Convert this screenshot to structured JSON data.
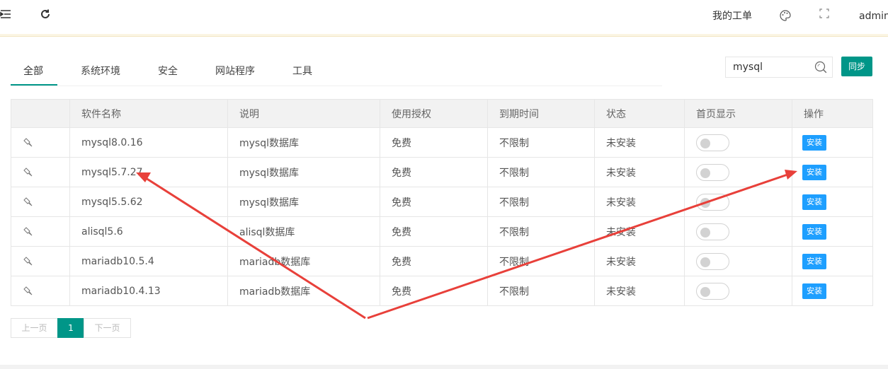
{
  "topbar": {
    "menu_icon": "menu-fold-icon",
    "refresh_icon": "refresh-icon",
    "workorder_label": "我的工单",
    "theme_icon": "palette-icon",
    "fullscreen_icon": "fullscreen-icon",
    "user_label": "admin"
  },
  "tabs": [
    {
      "label": "全部",
      "active": true
    },
    {
      "label": "系统环境",
      "active": false
    },
    {
      "label": "安全",
      "active": false
    },
    {
      "label": "网站程序",
      "active": false
    },
    {
      "label": "工具",
      "active": false
    }
  ],
  "search": {
    "value": "mysql",
    "icon": "search-icon"
  },
  "sync_label": "同步",
  "table": {
    "headers": [
      "",
      "软件名称",
      "说明",
      "使用授权",
      "到期时间",
      "状态",
      "首页显示",
      "操作"
    ],
    "rows": [
      {
        "name": "mysql8.0.16",
        "desc": "mysql数据库",
        "license": "免费",
        "expire": "不限制",
        "status": "未安装",
        "action": "安装"
      },
      {
        "name": "mysql5.7.27",
        "desc": "mysql数据库",
        "license": "免费",
        "expire": "不限制",
        "status": "未安装",
        "action": "安装"
      },
      {
        "name": "mysql5.5.62",
        "desc": "mysql数据库",
        "license": "免费",
        "expire": "不限制",
        "status": "未安装",
        "action": "安装"
      },
      {
        "name": "alisql5.6",
        "desc": "alisql数据库",
        "license": "免费",
        "expire": "不限制",
        "status": "未安装",
        "action": "安装"
      },
      {
        "name": "mariadb10.5.4",
        "desc": "mariadb数据库",
        "license": "免费",
        "expire": "不限制",
        "status": "未安装",
        "action": "安装"
      },
      {
        "name": "mariadb10.4.13",
        "desc": "mariadb数据库",
        "license": "免费",
        "expire": "不限制",
        "status": "未安装",
        "action": "安装"
      }
    ]
  },
  "pager": {
    "prev": "上一页",
    "current": "1",
    "next": "下一页"
  },
  "colors": {
    "accent": "#009688",
    "button_blue": "#1e9fff",
    "annotation_red": "#e8403a"
  }
}
